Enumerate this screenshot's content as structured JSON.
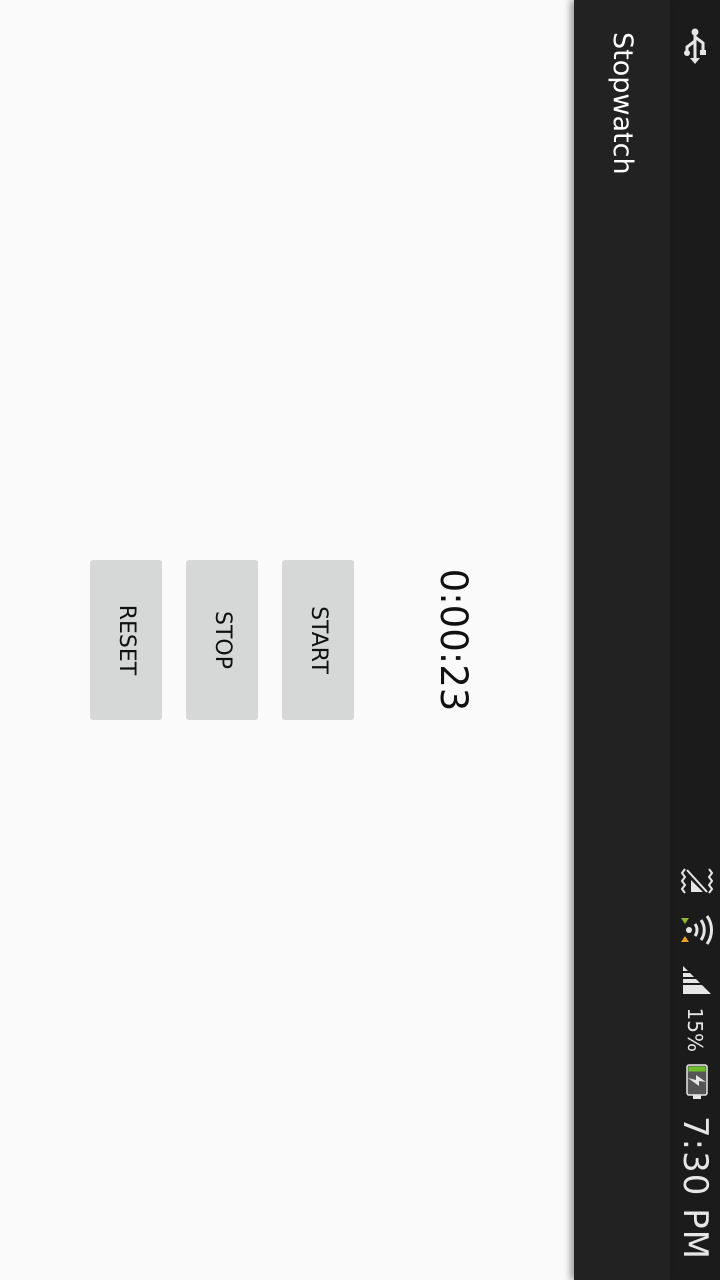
{
  "status_bar": {
    "time": "7:30 PM",
    "battery_percent": "15%",
    "icons": [
      "usb-icon",
      "no-sim-icon",
      "wifi-icon",
      "data-transfer-icon",
      "signal-icon",
      "battery-charging-icon"
    ]
  },
  "action_bar": {
    "title": "Stopwatch"
  },
  "stopwatch": {
    "time": "0:00:23"
  },
  "buttons": {
    "start": "START",
    "stop": "STOP",
    "reset": "RESET"
  },
  "colors": {
    "background": "#fafafa",
    "action_bar": "#222222",
    "status_bar": "#1b1b1b",
    "button": "#d6d7d7",
    "data_arrows_up": "#8ab834",
    "data_arrows_down": "#f0a020",
    "battery_fill": "#6fbf2a"
  }
}
